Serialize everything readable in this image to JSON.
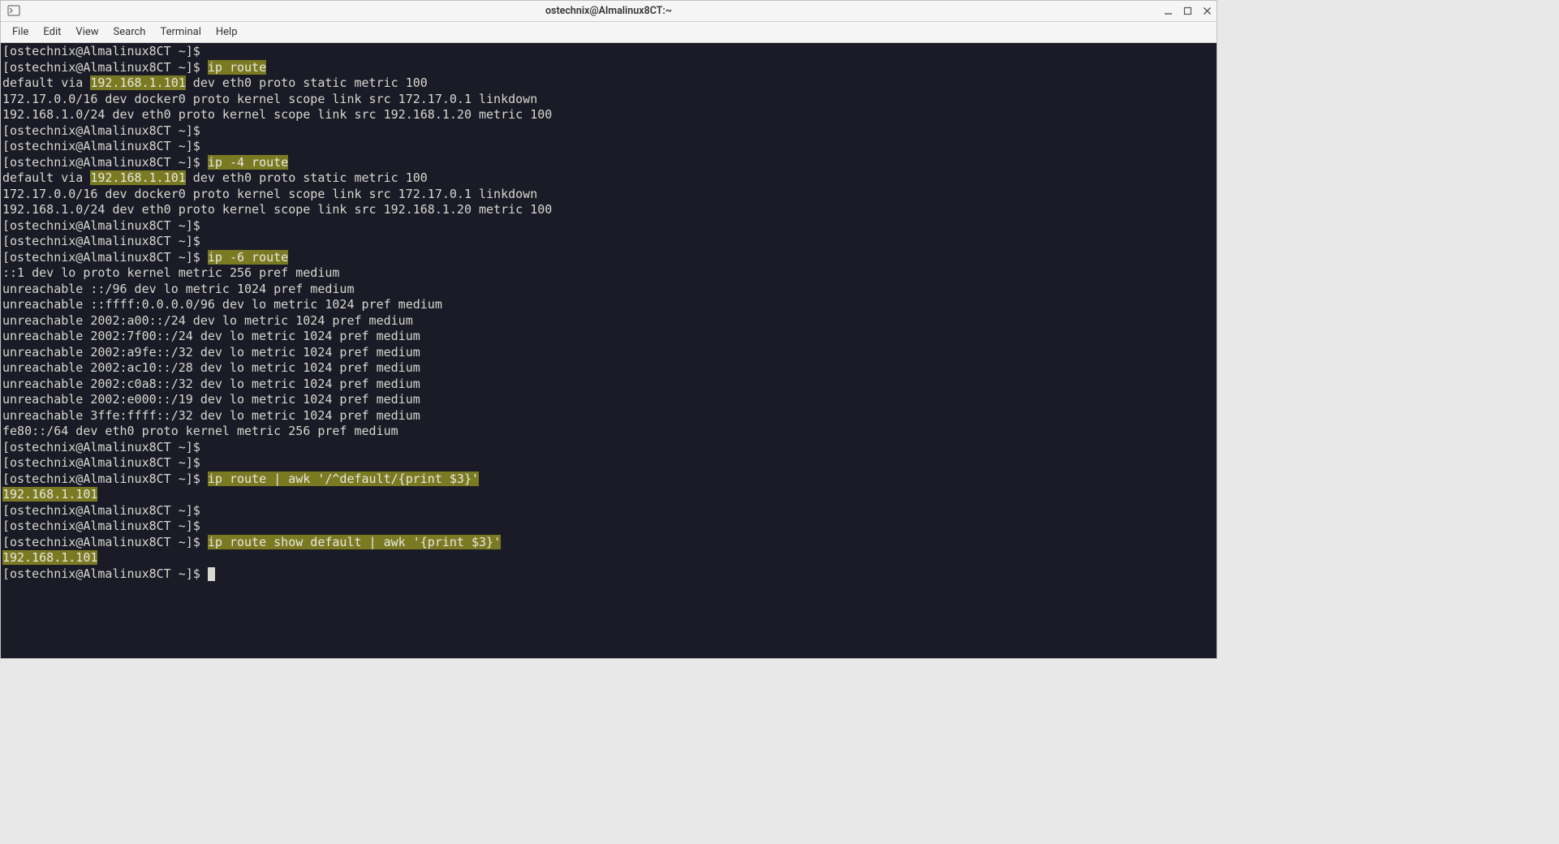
{
  "titlebar": {
    "title": "ostechnix@Almalinux8CT:~"
  },
  "menubar": {
    "items": [
      "File",
      "Edit",
      "View",
      "Search",
      "Terminal",
      "Help"
    ]
  },
  "terminal": {
    "prompt": "[ostechnix@Almalinux8CT ~]$",
    "lines": [
      {
        "t": "prompt_blank"
      },
      {
        "t": "prompt_cmd",
        "cmd": "ip route"
      },
      {
        "t": "out_hl_gateway_line",
        "pre": "default via ",
        "hl": "192.168.1.101",
        "post": " dev eth0 proto static metric 100"
      },
      {
        "t": "out",
        "text": "172.17.0.0/16 dev docker0 proto kernel scope link src 172.17.0.1 linkdown"
      },
      {
        "t": "out",
        "text": "192.168.1.0/24 dev eth0 proto kernel scope link src 192.168.1.20 metric 100"
      },
      {
        "t": "prompt_blank"
      },
      {
        "t": "prompt_blank"
      },
      {
        "t": "prompt_cmd",
        "cmd": "ip -4 route"
      },
      {
        "t": "out_hl_gateway_line",
        "pre": "default via ",
        "hl": "192.168.1.101",
        "post": " dev eth0 proto static metric 100"
      },
      {
        "t": "out",
        "text": "172.17.0.0/16 dev docker0 proto kernel scope link src 172.17.0.1 linkdown"
      },
      {
        "t": "out",
        "text": "192.168.1.0/24 dev eth0 proto kernel scope link src 192.168.1.20 metric 100"
      },
      {
        "t": "prompt_blank"
      },
      {
        "t": "prompt_blank"
      },
      {
        "t": "prompt_cmd",
        "cmd": "ip -6 route"
      },
      {
        "t": "out",
        "text": "::1 dev lo proto kernel metric 256 pref medium"
      },
      {
        "t": "out",
        "text": "unreachable ::/96 dev lo metric 1024 pref medium"
      },
      {
        "t": "out",
        "text": "unreachable ::ffff:0.0.0.0/96 dev lo metric 1024 pref medium"
      },
      {
        "t": "out",
        "text": "unreachable 2002:a00::/24 dev lo metric 1024 pref medium"
      },
      {
        "t": "out",
        "text": "unreachable 2002:7f00::/24 dev lo metric 1024 pref medium"
      },
      {
        "t": "out",
        "text": "unreachable 2002:a9fe::/32 dev lo metric 1024 pref medium"
      },
      {
        "t": "out",
        "text": "unreachable 2002:ac10::/28 dev lo metric 1024 pref medium"
      },
      {
        "t": "out",
        "text": "unreachable 2002:c0a8::/32 dev lo metric 1024 pref medium"
      },
      {
        "t": "out",
        "text": "unreachable 2002:e000::/19 dev lo metric 1024 pref medium"
      },
      {
        "t": "out",
        "text": "unreachable 3ffe:ffff::/32 dev lo metric 1024 pref medium"
      },
      {
        "t": "out",
        "text": "fe80::/64 dev eth0 proto kernel metric 256 pref medium"
      },
      {
        "t": "prompt_blank"
      },
      {
        "t": "prompt_blank"
      },
      {
        "t": "prompt_cmd",
        "cmd": "ip route | awk '/^default/{print $3}'"
      },
      {
        "t": "out_hl_full",
        "text": "192.168.1.101"
      },
      {
        "t": "prompt_blank"
      },
      {
        "t": "prompt_blank"
      },
      {
        "t": "prompt_cmd",
        "cmd": "ip route show default | awk '{print $3}'"
      },
      {
        "t": "out_hl_full",
        "text": "192.168.1.101"
      },
      {
        "t": "prompt_cursor"
      }
    ]
  },
  "colors": {
    "highlight_bg": "#7a7a23",
    "terminal_bg": "#1a1b26",
    "terminal_fg": "#d8d8d0"
  }
}
